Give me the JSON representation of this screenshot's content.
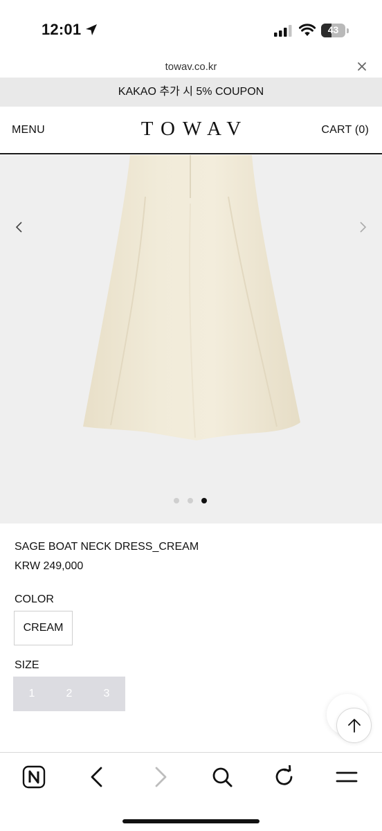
{
  "status_bar": {
    "time": "12:01",
    "battery_level": "43",
    "battery_fraction": 0.43,
    "icons": [
      "location-arrow-icon",
      "cellular-signal-icon",
      "wifi-icon",
      "battery-icon"
    ]
  },
  "url_bar": {
    "url": "towav.co.kr",
    "close_icon": "close-icon"
  },
  "promo": {
    "text": "KAKAO 추가 시 5% COUPON"
  },
  "header": {
    "menu_label": "MENU",
    "logo": "TOWAV",
    "cart_label": "CART (0)"
  },
  "gallery": {
    "slide_count": 3,
    "active_slide": 3,
    "prev_icon": "chevron-left-icon",
    "next_icon": "chevron-right-icon",
    "background_color": "#efefef",
    "product_color": "#f0e9d6"
  },
  "product": {
    "name": "SAGE BOAT NECK DRESS_CREAM",
    "price": "KRW 249,000",
    "color_label": "COLOR",
    "color_options": [
      "CREAM"
    ],
    "size_label": "SIZE",
    "size_options": [
      "1",
      "2",
      "3"
    ]
  },
  "scroll_top": {
    "icon": "arrow-up-icon"
  },
  "toolbar": {
    "items": [
      "naver-home-icon",
      "back-icon",
      "forward-icon",
      "search-icon",
      "reload-icon",
      "menu-icon"
    ]
  }
}
